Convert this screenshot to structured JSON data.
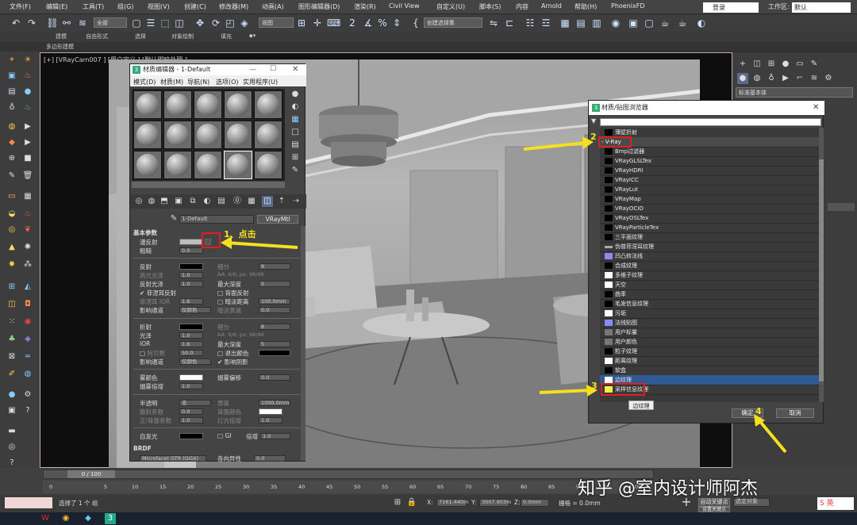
{
  "menubar": {
    "items": [
      "文件(F)",
      "编辑(E)",
      "工具(T)",
      "组(G)",
      "视图(V)",
      "创建(C)",
      "修改器(M)",
      "动画(A)",
      "图形编辑器(D)",
      "渲染(R)",
      "Civil View",
      "自定义(U)",
      "脚本(S)",
      "内容",
      "Arnold",
      "帮助(H)",
      "PhoenixFD"
    ],
    "login": "登录",
    "workspace_label": "工作区:",
    "workspace_value": "默认"
  },
  "toolbar": {
    "filter_select": "全部",
    "view_select": "视图",
    "selection_set": "创建选择集"
  },
  "ribbon": {
    "tabs": [
      "建模",
      "自由形式",
      "选择",
      "对象绘制",
      "填充"
    ],
    "subtitle": "多边形建模"
  },
  "viewport": {
    "label": "[+] [VRayCam007 ] [用户定义 ] [默认明暗处理 ]"
  },
  "right_panel": {
    "category": "标准基本体"
  },
  "material_editor": {
    "title": "材质编辑器 - 1-Default",
    "menu": [
      "模式(D)",
      "材质(M)",
      "导航(N)",
      "选项(O)",
      "实用程序(U)"
    ],
    "material_name": "1-Default",
    "material_type": "VRayMtl",
    "rollout_basic": "基本参数",
    "diffuse": "漫反射",
    "roughness": "粗糙",
    "roughness_val": "0.0",
    "reflect": "反射",
    "gloss": "高光光泽",
    "gloss_val": "1.0",
    "refl_gloss": "反射光泽",
    "refl_gloss_val": "1.0",
    "fresnel": "菲涅耳反射",
    "fresnel_ior": "菲涅耳 IOR",
    "fresnel_ior_val": "1.6",
    "affect_channels": "影响通道",
    "affect_val": "仅颜色",
    "subdivs": "细分",
    "subdivs_val": "8",
    "aa": "AA: 6/6; px: 96/96",
    "max_depth": "最大深度",
    "max_depth_val": "5",
    "back_reflect": "背面反射",
    "dim_distance": "暗淡距离",
    "dim_distance_val": "100.0mm",
    "dim_falloff": "暗淡衰减",
    "dim_falloff_val": "0.0",
    "refract": "折射",
    "glossiness": "光泽",
    "glossiness_val": "1.0",
    "ior": "IOR",
    "ior_val": "1.6",
    "abbe": "阿贝数",
    "abbe_val": "50.0",
    "refr_affect": "影响通道",
    "refr_affect_val": "仅颜色",
    "refr_subdivs": "细分",
    "refr_subdivs_val": "8",
    "refr_aa": "AA: 6/6; px: 96/96",
    "refr_max_depth": "最大深度",
    "refr_max_depth_val": "5",
    "exit_color": "退出颜色",
    "affect_shadows": "影响阴影",
    "fog_color": "雾颜色",
    "fog_mult": "烟雾倍增",
    "fog_mult_val": "1.0",
    "fog_bias": "烟雾偏移",
    "fog_bias_val": "0.0",
    "translucency": "半透明",
    "translucency_val": "无",
    "scatter_coeff": "散射系数",
    "scatter_val": "0.0",
    "fwd_back": "正/背面系数",
    "fwd_back_val": "1.0",
    "thickness": "厚度",
    "thickness_val": "1000.0mm",
    "back_color": "背面颜色",
    "light_mult": "灯光倍增",
    "light_mult_val": "1.0",
    "self_illum": "自发光",
    "gi": "GI",
    "multiplier": "倍增",
    "multiplier_val": "1.0",
    "rollout_brdf": "BRDF",
    "brdf_type": "Microfacet GTR (GGX)",
    "aniso": "各向异性",
    "aniso_val": "0.0"
  },
  "material_browser": {
    "title": "材质/贴图浏览器",
    "rows": [
      "薄壁折射",
      "- V-Ray",
      "Bmp过滤器",
      "VRayGLSLTex",
      "VRayHDRI",
      "VRayICC",
      "VRayLut",
      "VRayMap",
      "VRayOCIO",
      "VRayOSLTex",
      "VRayParticleTex",
      "三平面纹理",
      "伪普菲涅耳纹理",
      "凹凸转法线",
      "合成纹理",
      "多维子纹理",
      "天空",
      "曲率",
      "毛发信息纹理",
      "污垢",
      "法线贴图",
      "用户标量",
      "用户颜色",
      "粒子纹理",
      "距离纹理",
      "软盒",
      "边纹理",
      "采样信息纹理"
    ],
    "tooltip": "边纹理",
    "ok": "确定",
    "cancel": "取消"
  },
  "annotations": {
    "step1": "1、点击",
    "step2": "2",
    "step3": "3",
    "step4": "4"
  },
  "timeline": {
    "frame": "0 / 100",
    "ticks": [
      "0",
      "5",
      "10",
      "15",
      "20",
      "25",
      "30",
      "35",
      "40",
      "45",
      "50",
      "55",
      "60",
      "65",
      "70",
      "75",
      "80",
      "85",
      "90",
      "95",
      "100"
    ]
  },
  "status": {
    "selected": "选择了 1 个 组",
    "x_label": "X:",
    "x_val": "7161.440m",
    "y_label": "Y:",
    "y_val": "3007.903m",
    "z_label": "Z:",
    "z_val": "0.0mm",
    "grid": "栅格 = 0.0mm",
    "auto_key": "自动关键点",
    "selected_obj": "选定对象",
    "set_key": "设置关键点"
  },
  "watermark": "知乎 @室内设计师阿杰",
  "taskbar": {
    "ime": "英"
  }
}
